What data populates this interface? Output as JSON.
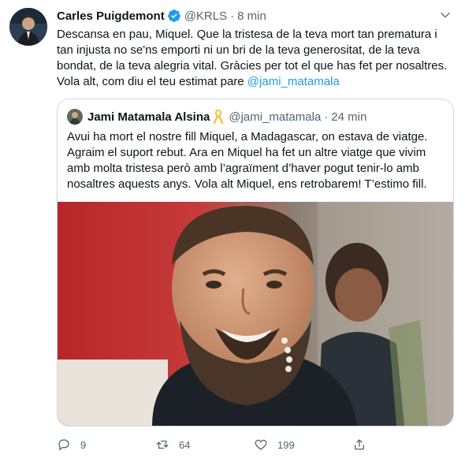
{
  "tweet": {
    "author_name": "Carles Puigdemont",
    "author_handle": "@KRLS",
    "separator": "·",
    "time": "8 min",
    "text_plain": "Descansa en pau, Miquel. Que la tristesa de la teva mort tan prematura i tan injusta no se'ns emporti ni un bri de la teva generositat, de la teva bondat, de la teva alegria vital. Gràcies per tot el que has fet per nosaltres. Vola alt, com diu el teu estimat pare ",
    "mention": "@jami_matamala"
  },
  "quote": {
    "author_name": "Jami Matamala Alsina",
    "author_handle": "@jami_matamala",
    "separator": "·",
    "time": "24 min",
    "text": "Avui ha mort el nostre fill Miquel, a Madagascar, on estava de viatge. Agraim el suport rebut. Ara en Miquel ha fet un altre viatge que vivim amb molta tristesa però amb l’agraïment d’haver pogut tenir-lo amb nosaltres aquests anys. Vola alt Miquel, ens retrobarem! T’estimo fill."
  },
  "actions": {
    "replies": "9",
    "retweets": "64",
    "likes": "199"
  },
  "icons": {
    "verified": "verified-badge-icon",
    "caret": "chevron-down-icon",
    "ribbon": "yellow-ribbon-icon",
    "reply": "reply-icon",
    "retweet": "retweet-icon",
    "like": "heart-icon",
    "share": "share-icon"
  },
  "colors": {
    "accent": "#1d9bf0",
    "text": "#0f1419",
    "secondary": "#536471",
    "border": "#cfd9de",
    "ribbon": "#f4c542"
  }
}
